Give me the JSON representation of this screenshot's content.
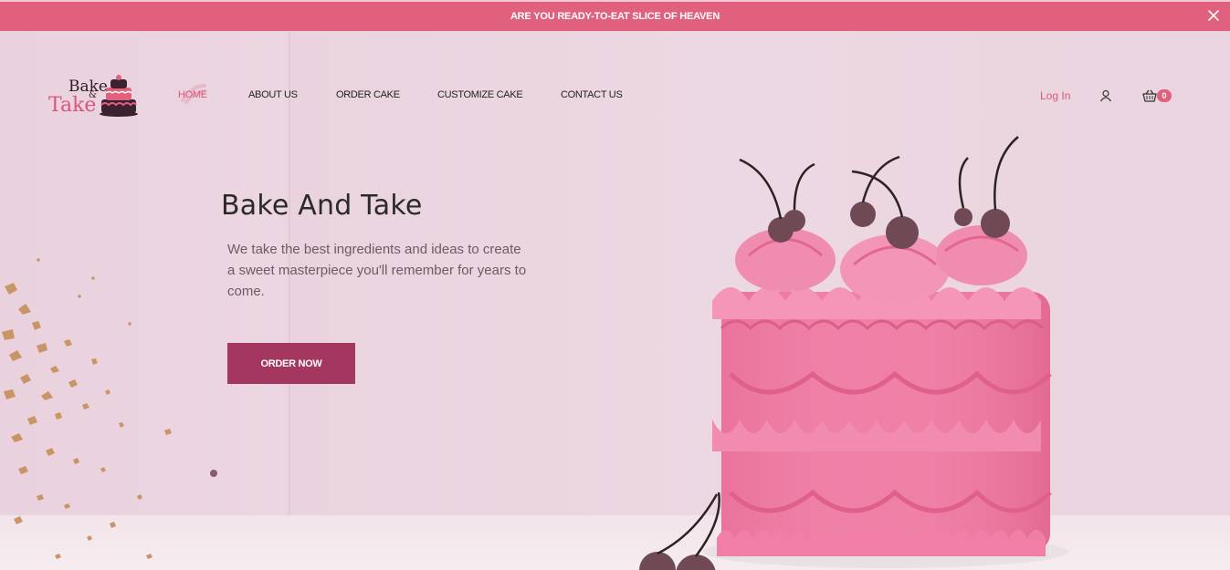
{
  "announcement": {
    "text": "ARE YOU READY-TO-EAT SLICE OF HEAVEN",
    "close_icon": "close-icon"
  },
  "logo": {
    "line1": "Bake",
    "amp": "&",
    "line2": "Take"
  },
  "nav": {
    "items": [
      {
        "label": "HOME",
        "active": true
      },
      {
        "label": "ABOUT US",
        "active": false
      },
      {
        "label": "ORDER CAKE",
        "active": false
      },
      {
        "label": "CUSTOMIZE CAKE",
        "active": false
      },
      {
        "label": "CONTACT US",
        "active": false
      }
    ]
  },
  "account": {
    "login_label": "Log In",
    "user_icon": "user-icon",
    "cart_icon": "cart-icon",
    "cart_count": "0"
  },
  "hero": {
    "title": "Bake And Take",
    "subtitle": "We take the best ingredients and ideas to create a sweet masterpiece you'll remember for years to come.",
    "cta_label": "ORDER NOW"
  },
  "colors": {
    "brand_pink": "#e0607d",
    "cta": "#a4375f",
    "hero_bg": "#ecd6e1"
  }
}
